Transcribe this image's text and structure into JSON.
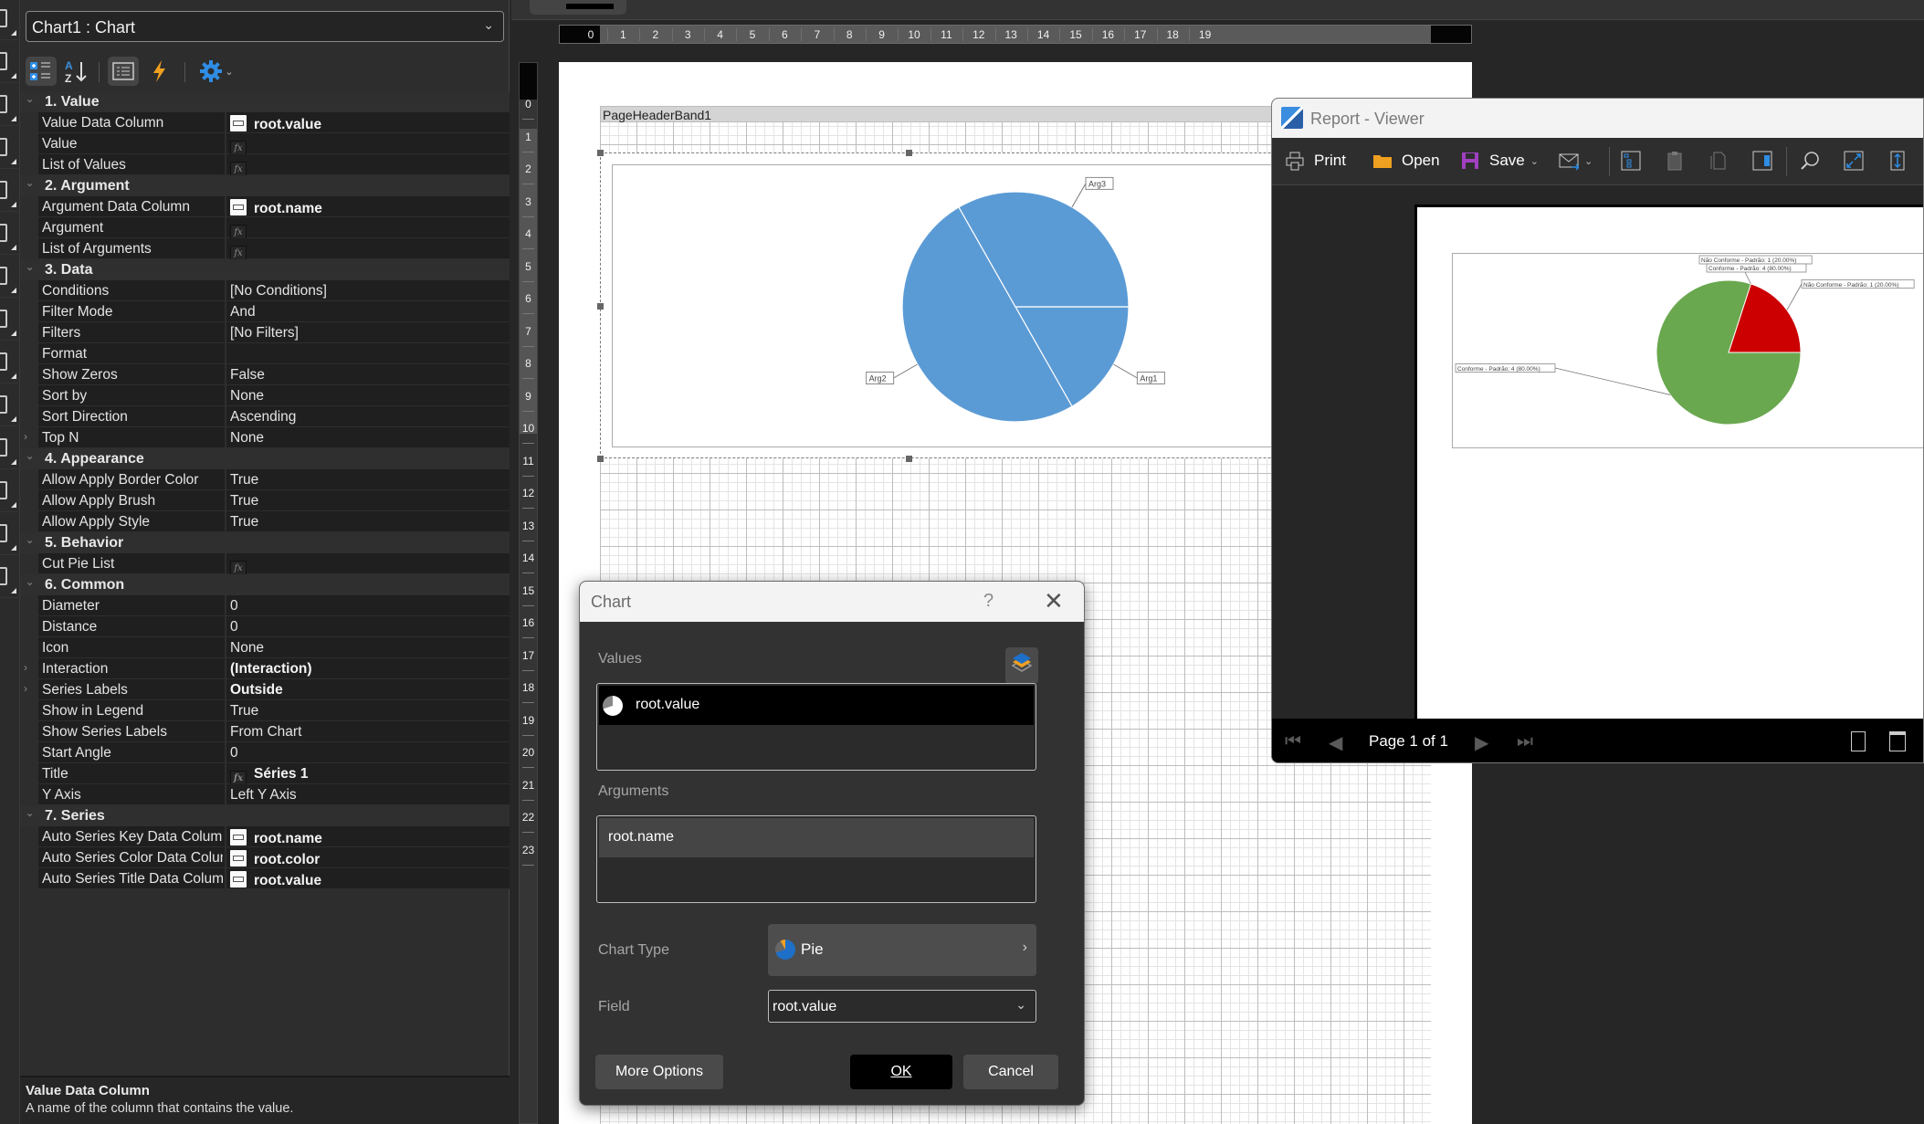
{
  "left_strip": {
    "buttons": 14
  },
  "properties": {
    "component": "Chart1 : Chart",
    "toolbar": [
      "categorized-view",
      "alphabetical-sort",
      "properties-tab",
      "events-tab",
      "settings"
    ],
    "categories": [
      {
        "label": "1. Value",
        "rows": [
          {
            "name": "Value Data Column",
            "value": "root.value",
            "icon": "column",
            "bold": true
          },
          {
            "name": "Value",
            "value": "",
            "icon": "fx"
          },
          {
            "name": "List of Values",
            "value": "",
            "icon": "fx"
          }
        ]
      },
      {
        "label": "2. Argument",
        "rows": [
          {
            "name": "Argument Data Column",
            "value": "root.name",
            "icon": "column",
            "bold": true
          },
          {
            "name": "Argument",
            "value": "",
            "icon": "fx"
          },
          {
            "name": "List of Arguments",
            "value": "",
            "icon": "fx"
          }
        ]
      },
      {
        "label": "3. Data",
        "rows": [
          {
            "name": "Conditions",
            "value": "[No Conditions]"
          },
          {
            "name": "Filter Mode",
            "value": "And"
          },
          {
            "name": "Filters",
            "value": "[No Filters]"
          },
          {
            "name": "Format",
            "value": ""
          },
          {
            "name": "Show Zeros",
            "value": "False"
          },
          {
            "name": "Sort by",
            "value": "None"
          },
          {
            "name": "Sort Direction",
            "value": "Ascending"
          },
          {
            "name": "Top N",
            "value": "None",
            "expandable": true
          }
        ]
      },
      {
        "label": "4. Appearance",
        "rows": [
          {
            "name": "Allow Apply Border Color",
            "value": "True"
          },
          {
            "name": "Allow Apply Brush",
            "value": "True"
          },
          {
            "name": "Allow Apply Style",
            "value": "True"
          }
        ]
      },
      {
        "label": "5. Behavior",
        "rows": [
          {
            "name": "Cut Pie List",
            "value": "",
            "icon": "fx"
          }
        ]
      },
      {
        "label": "6. Common",
        "rows": [
          {
            "name": "Diameter",
            "value": "0"
          },
          {
            "name": "Distance",
            "value": "0"
          },
          {
            "name": "Icon",
            "value": "None"
          },
          {
            "name": "Interaction",
            "value": "(Interaction)",
            "bold": true,
            "expandable": true
          },
          {
            "name": "Series Labels",
            "value": "Outside",
            "bold": true,
            "expandable": true
          },
          {
            "name": "Show in Legend",
            "value": "True"
          },
          {
            "name": "Show Series Labels",
            "value": "From Chart"
          },
          {
            "name": "Start Angle",
            "value": "0"
          },
          {
            "name": "Title",
            "value": "Séries 1",
            "icon": "fx",
            "bold": true
          },
          {
            "name": "Y Axis",
            "value": "Left Y Axis"
          }
        ]
      },
      {
        "label": "7. Series",
        "rows": [
          {
            "name": "Auto Series Key Data Column",
            "value": "root.name",
            "icon": "column",
            "bold": true
          },
          {
            "name": "Auto Series Color Data Column",
            "value": "root.color",
            "icon": "column",
            "bold": true
          },
          {
            "name": "Auto Series Title Data Column",
            "value": "root.value",
            "icon": "column",
            "bold": true
          }
        ]
      }
    ],
    "help": {
      "title": "Value Data Column",
      "text": "A name of the column that contains the value."
    }
  },
  "designer": {
    "hruler_ticks": [
      "0",
      "1",
      "2",
      "3",
      "4",
      "5",
      "6",
      "7",
      "8",
      "9",
      "10",
      "11",
      "12",
      "13",
      "14",
      "15",
      "16",
      "17",
      "18",
      "19"
    ],
    "vruler_ticks": [
      "0",
      "1",
      "2",
      "3",
      "4",
      "5",
      "6",
      "7",
      "8",
      "9",
      "10",
      "11",
      "12",
      "13",
      "14",
      "15",
      "16",
      "17",
      "18",
      "19",
      "20",
      "21",
      "22",
      "23"
    ],
    "band_title": "PageHeaderBand1",
    "design_chart": {
      "color": "#5b9bd5",
      "slices": [
        {
          "label": "Arg1",
          "value": 1
        },
        {
          "label": "Arg2",
          "value": 3
        },
        {
          "label": "Arg3",
          "value": 2
        }
      ]
    }
  },
  "chart_dialog": {
    "title": "Chart",
    "help_label": "?",
    "values_label": "Values",
    "values_item": "root.value",
    "arguments_label": "Arguments",
    "arguments_item": "root.name",
    "chart_type_label": "Chart Type",
    "chart_type_value": "Pie",
    "field_label": "Field",
    "field_value": "root.value",
    "more_options": "More Options",
    "ok": "OK",
    "cancel": "Cancel"
  },
  "viewer": {
    "title": "Report - Viewer",
    "toolbar": {
      "print": "Print",
      "open": "Open",
      "save": "Save"
    },
    "page_indicator": "Page 1 of 1"
  },
  "chart_data": [
    {
      "type": "pie",
      "title": "",
      "context": "designer preview",
      "categories": [
        "Arg1",
        "Arg2",
        "Arg3"
      ],
      "values": [
        1,
        3,
        2
      ],
      "colors": [
        "#5b9bd5",
        "#5b9bd5",
        "#5b9bd5"
      ],
      "start_angle": 0,
      "labels": "outside"
    },
    {
      "type": "pie",
      "title": "",
      "context": "report viewer",
      "categories": [
        "Não Conforme - Padrão",
        "Conforme - Padrão"
      ],
      "values": [
        1,
        4
      ],
      "percent": [
        20.0,
        80.0
      ],
      "colors": [
        "#cc0000",
        "#6aa84f"
      ],
      "labels": [
        "Não Conforme - Padrão: 1 (20.00%)",
        "Conforme - Padrão: 4 (80.00%)"
      ],
      "extra_labels": [
        "Não Conforme - Padrão: 1 (20.00%)",
        "Conforme - Padrão: 4 (80.00%)"
      ],
      "start_angle": 0
    }
  ]
}
